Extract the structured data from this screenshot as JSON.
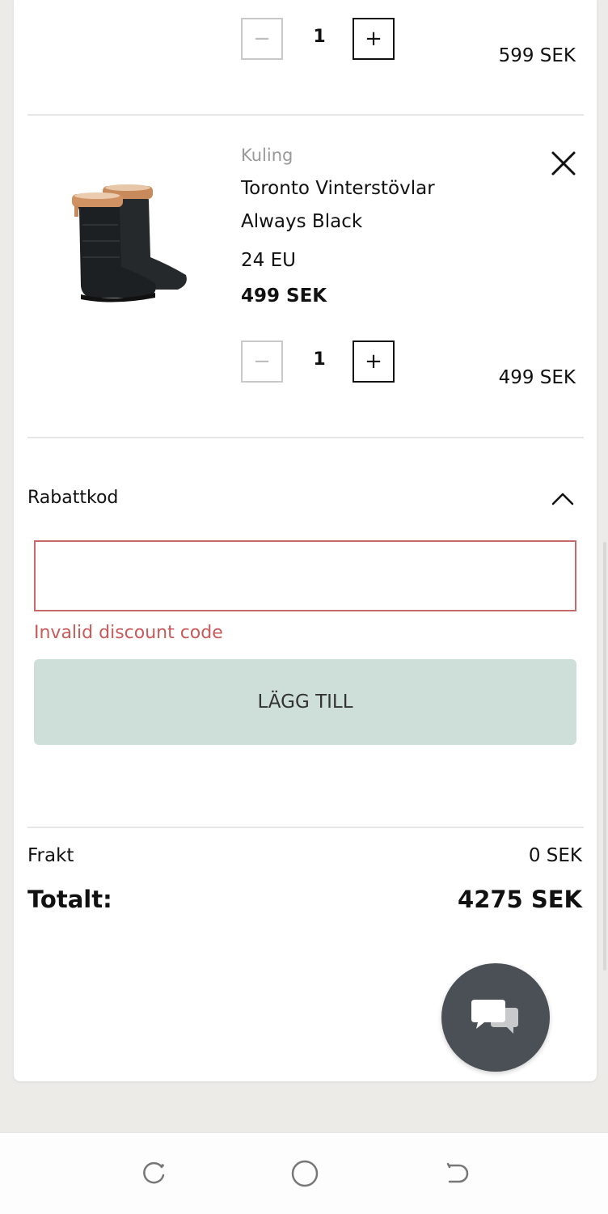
{
  "cart": {
    "item1": {
      "quantity": "1",
      "line_total": "599 SEK"
    },
    "item2": {
      "brand": "Kuling",
      "name_line1": "Toronto Vinterstövlar",
      "name_line2": "Always Black",
      "size": "24 EU",
      "price": "499 SEK",
      "quantity": "1",
      "line_total": "499 SEK"
    }
  },
  "discount": {
    "label": "Rabattkod",
    "value": "",
    "placeholder": "",
    "error": "Invalid discount code",
    "add_label": "LÄGG TILL"
  },
  "summary": {
    "shipping_label": "Frakt",
    "shipping_value": "0 SEK",
    "total_label": "Totalt:",
    "total_value": "4275 SEK"
  },
  "icons": {
    "quantity_minus": "minus-icon",
    "quantity_plus": "plus-icon",
    "remove": "close-icon",
    "collapse": "chevron-up-icon",
    "chat": "chat-bubbles-icon",
    "nav_recent": "recent-apps-icon",
    "nav_home": "home-icon",
    "nav_back": "back-icon"
  },
  "colors": {
    "error": "#c85a5a",
    "error_border": "#c46a6a",
    "add_button_bg": "#cddfd8",
    "chat_button_bg": "#4a5055",
    "page_bg": "#ecebe7"
  }
}
